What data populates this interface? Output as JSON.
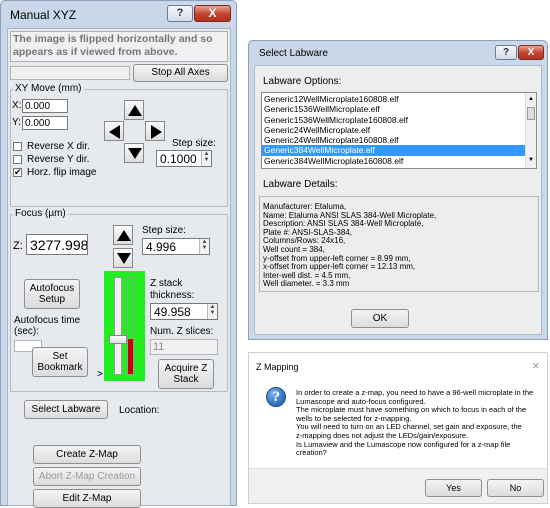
{
  "colors": {
    "window_bg": "#e6eaef",
    "selection": "#3399ff",
    "green_panel": "#22ee22",
    "slider_red": "#cc0000",
    "info_icon": "#2a6db8"
  },
  "manual_xyz": {
    "title": "Manual XYZ",
    "help_label": "?",
    "close_label": "X",
    "flip_message": "The image is flipped horizontally and so appears as if viewed from above.",
    "stop_all_axes": "Stop All Axes",
    "xy_move": {
      "title": "XY Move (mm)",
      "x_label": "X:",
      "x_value": "0.000",
      "y_label": "Y:",
      "y_value": "0.000",
      "reverse_x": "Reverse X dir.",
      "reverse_y": "Reverse Y dir.",
      "horz_flip": "Horz. flip image",
      "horz_flip_check": "✔",
      "step_size_label": "Step size:",
      "step_size_value": "0.1000"
    },
    "focus": {
      "title": "Focus (µm)",
      "z_label": "Z:",
      "z_value": "3277.998",
      "step_size_label": "Step size:",
      "step_size_value": "4.996",
      "autofocus_setup": "Autofocus Setup",
      "autofocus_time_label": "Autofocus time (sec):",
      "z_stack_label": "Z stack thickness:",
      "z_stack_value": "49.958",
      "num_z_slices_label": "Num. Z slices:",
      "num_z_slices_value": "11",
      "acquire_z_stack": "Acquire Z Stack",
      "set_bookmark": "Set Bookmark",
      "bookmark_marker": ">"
    },
    "select_labware": "Select Labware",
    "location_label": "Location:",
    "create_z_map": "Create Z-Map",
    "abort_z_map": "Abort Z-Map Creation",
    "edit_z_map": "Edit Z-Map"
  },
  "select_labware": {
    "title": "Select Labware",
    "help_label": "?",
    "close_label": "X",
    "options_label": "Labware Options:",
    "options": [
      "Generic12WellMicroplate160808.elf",
      "Generic1536WellMicroplate.elf",
      "Generic1536WellMicroplate160808.elf",
      "Generic24WellMicroplate.elf",
      "Generic24WellMicroplate160808.elf",
      "Generic384WellMicroplate.elf",
      "Generic384WellMicroplate160808.elf"
    ],
    "selected_index": 5,
    "details_label": "Labware Details:",
    "details": [
      "Manufacturer: Etaluma,",
      "Name: Etaluma ANSI SLAS 384-Well Microplate,",
      "Description: ANSI SLAS 384-Well Microplate,",
      "Plate #: ANSI-SLAS-384,",
      "Columns/Rows: 24x16,",
      "Well count = 384,",
      "y-offset from upper-left corner = 8.99 mm,",
      "x-offset from upper-left corner = 12.13 mm,",
      "Inter-well dist. = 4.5 mm,",
      "Well diameter. = 3.3 mm"
    ],
    "ok_label": "OK"
  },
  "z_mapping": {
    "title": "Z Mapping",
    "close_label": "×",
    "message": [
      "In order to create a z-map, you need to have a 96-well microplate in the",
      "Lumascope and auto-focus configured.",
      "The microplate must have something on which to focus in each of the",
      "wells to be selected for z-mapping.",
      "You will need to turn on an LED channel, set gain and exposure, the",
      "z-mapping does not adjust the LEDs/gain/exposure.",
      "Is Lumaview and the Lumascope now configured for a z-map file",
      "creation?"
    ],
    "yes_label": "Yes",
    "no_label": "No"
  }
}
